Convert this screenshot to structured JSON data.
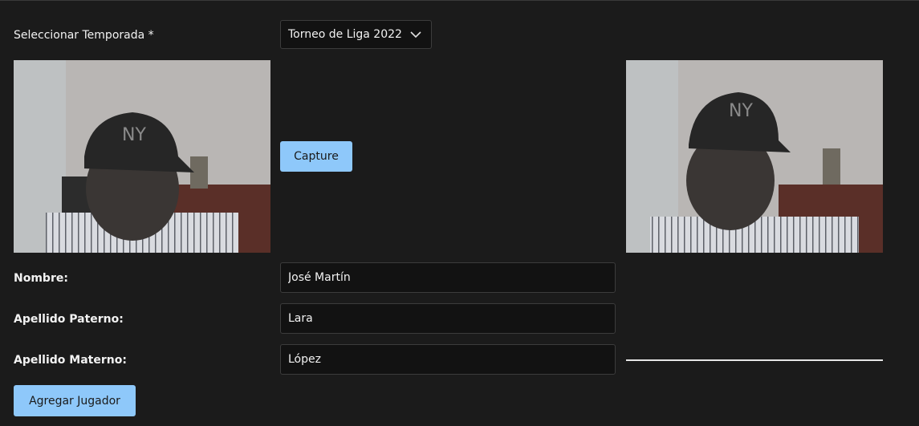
{
  "season": {
    "label": "Seleccionar Temporada *",
    "selected": "Torneo de Liga 2022"
  },
  "camera": {
    "capture_label": "Capture"
  },
  "form": {
    "nombre_label": "Nombre:",
    "nombre_value": "José Martín",
    "paterno_label": "Apellido Paterno:",
    "paterno_value": "Lara",
    "materno_label": "Apellido Materno:",
    "materno_value": "López",
    "submit_label": "Agregar Jugador"
  },
  "colors": {
    "background": "#1b1b1b",
    "accent_button": "#8ec8fa",
    "input_background": "#121212"
  }
}
